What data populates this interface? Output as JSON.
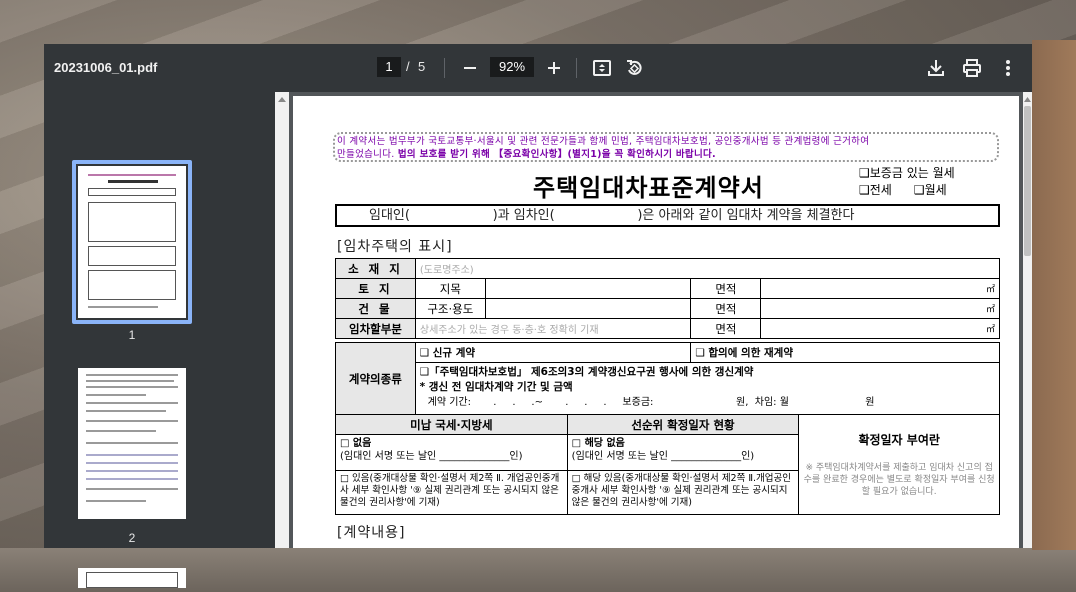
{
  "toolbar": {
    "filename": "20231006_01.pdf",
    "current_page": "1",
    "page_sep": "/",
    "total_pages": "5",
    "zoom": "92%"
  },
  "sidebar": {
    "thumbs": [
      {
        "label": "1"
      },
      {
        "label": "2"
      }
    ]
  },
  "doc": {
    "notice_line1": "이 계약서는 법무부가 국토교통부·서울시 및 관련 전문가들과 함께 민법, 주택임대차보호법, 공인중개사법 등 관계법령에 근거하여",
    "notice_line2a": "만들었습니다. ",
    "notice_line2b": "법의 보호를 받기 위해 【중요확인사항】(별지1)을 꼭 확인하시기 바랍니다.",
    "title": "주택임대차표준계약서",
    "opt1": "❑보증금 있는 월세",
    "opt2": "❑전세",
    "opt3": "❑월세",
    "intro": "임대인(                    )과 임차인(                    )은 아래와 같이 임대차 계약을 체결한다",
    "section1": "[임차주택의 표시]",
    "row_location_label": "소 재 지",
    "row_location_hint": "(도로명주소)",
    "row_land_label": "토    지",
    "row_land_kind": "지목",
    "area_label": "면적",
    "unit_m2": "㎡",
    "row_building_label": "건    물",
    "row_building_kind": "구조·용도",
    "row_leased_label": "임차할부분",
    "row_leased_hint": "상세주소가 있는 경우 동·층·호 정확히 기재",
    "contract_type_label": "계약의종류",
    "ct_new": "❑ 신규 계약",
    "ct_renew_agree": "❑ 합의에 의한 재계약",
    "ct_renew_right": "❑「주택임대차보호법」 제6조의3의 계약갱신요구권 행사에 의한 갱신계약",
    "ct_prev": "* 갱신 전 임대차계약 기간 및 금액",
    "ct_period": "계약 기간:       .     .     .~       .     .     .     보증금:                          원,  차임: 월                        원",
    "tax_header": "미납 국세·지방세",
    "priority_header": "선순위 확정일자 현황",
    "tax_none": "□ 없음",
    "tax_none_sign": "(임대인 서명 또는 날인 ______________인)",
    "tax_exist": "□ 있음(중개대상물 확인·설명서 제2쪽 Ⅱ. 개업공인중개사 세부 확인사항 '⑨ 실제 권리관계 또는 공시되지 않은 물건의 권리사항'에 기재)",
    "pr_none": "□ 해당 없음",
    "pr_none_sign": "(임대인 서명 또는 날인 ______________인)",
    "pr_exist": "□ 해당 있음(중개대상물 확인·설명서 제2쪽 Ⅱ.개업공인중개사 세부 확인사항 '⑨ 실제 권리관계 또는 공시되지 않은 물건의 권리사항'에 기재)",
    "fixed_date_title": "확정일자 부여란",
    "fixed_date_note": "※ 주택임대차계약서를 제출하고 임대차 신고의 접수를 완료한 경우에는 별도로 확정일자 부여를 신청할 필요가 없습니다.",
    "section2": "[계약내용]"
  }
}
